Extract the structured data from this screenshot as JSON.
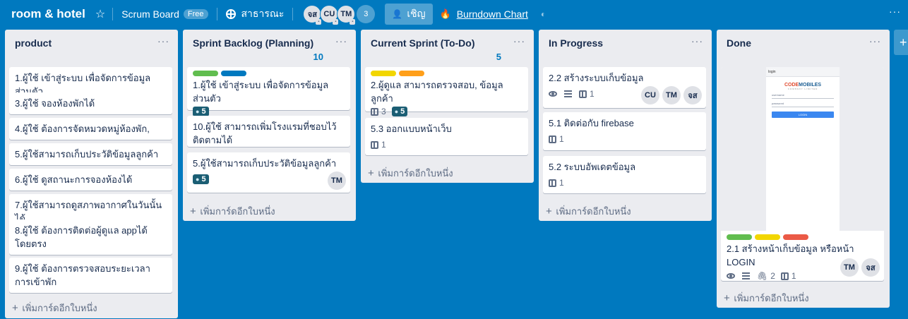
{
  "header": {
    "board_title": "room & hotel",
    "board_type": "Scrum Board",
    "free_badge": "Free",
    "visibility": "สาธารณะ",
    "members": [
      "จส",
      "CU",
      "TM"
    ],
    "member_count": "3",
    "invite_label": "เชิญ",
    "burndown_label": "Burndown Chart",
    "more": "···"
  },
  "lists": [
    {
      "title": "product",
      "count": "",
      "cards": [
        {
          "text": "1.ผู้ใช้ เข้าสู่ระบบ เพื่อจัดการข้อมูลส่วนตัว"
        },
        {
          "text": "3.ผู้ใช้ จองห้องพักได้"
        },
        {
          "text": "4.ผู้ใช้ ต้องการจัดหมวดหมู่ห้องพัก,"
        },
        {
          "text": "5.ผู้ใช้สามารถเก็บประวัติข้อมูลลูกค้า"
        },
        {
          "text": "6.ผู้ใช้ ดูสถานะการจองห้องได้"
        },
        {
          "text": "7.ผู้ใช้สามารถดูสภาพอากาศในวันนั้นได้"
        },
        {
          "text": "8.ผู้ใช้ ต้องการติดต่อผู้ดูแล appได้โดยตรง"
        },
        {
          "text": "9.ผู้ใช้ ต้องการตรวจสอบระยะเวลา การเข้าพัก"
        }
      ],
      "add_card": "เพิ่มการ์ดอีกใบหนึ่ง"
    },
    {
      "title": "Sprint Backlog (Planning)",
      "count": "10",
      "cards": [
        {
          "text": "1.ผู้ใช้ เข้าสู่ระบบ เพื่อจัดการข้อมูลส่วนตัว",
          "labels": [
            "#61bd4f",
            "#0079bf"
          ],
          "points": "5"
        },
        {
          "text": "10.ผู้ใช้ สามารถเพิ่มโรงแรมที่ชอบไว้ติดตามได้"
        },
        {
          "text": "5.ผู้ใช้สามารถเก็บประวัติข้อมูลลูกค้า",
          "points": "5",
          "members": [
            "TM"
          ]
        }
      ],
      "add_card": "เพิ่มการ์ดอีกใบหนึ่ง"
    },
    {
      "title": "Current Sprint (To-Do)",
      "count": "5",
      "cards": [
        {
          "text": "2.ผู้ดูแล สามารถตรวจสอบ, ข้อมูลลูกค้า",
          "labels": [
            "#f2d600",
            "#ff9f1a"
          ],
          "checklist": "3",
          "points": "5"
        },
        {
          "text": "5.3 ออกแบบหน้าเว็บ",
          "checklist": "1"
        }
      ],
      "add_card": "เพิ่มการ์ดอีกใบหนึ่ง"
    },
    {
      "title": "In Progress",
      "count": "",
      "cards": [
        {
          "text": "2.2 สร้างระบบเก็บข้อมูล",
          "checklist": "1",
          "members": [
            "CU",
            "TM",
            "จส"
          ]
        },
        {
          "text": "5.1 ติดต่อกับ firebase",
          "checklist": "1"
        },
        {
          "text": "5.2 ระบบอัพเดตข้อมูล",
          "checklist": "1"
        }
      ],
      "add_card": "เพิ่มการ์ดอีกใบหนึ่ง"
    },
    {
      "title": "Done",
      "count": "",
      "cards": [
        {
          "text": "2.1 สร้างหน้าเก็บข้อมูล หรือหน้า LOGIN",
          "labels": [
            "#61bd4f",
            "#f2d600",
            "#eb5a46"
          ],
          "attachments": "2",
          "checklist": "1",
          "members": [
            "TM",
            "จส"
          ],
          "cover": {
            "title": "login",
            "logo_a": "CODE",
            "logo_b": "MOBILES",
            "logo_sub": "COMPANY LIMITED",
            "field1": "username",
            "field2": "password",
            "button": "LOGIN"
          }
        }
      ],
      "add_card": "เพิ่มการ์ดอีกใบหนึ่ง"
    }
  ]
}
